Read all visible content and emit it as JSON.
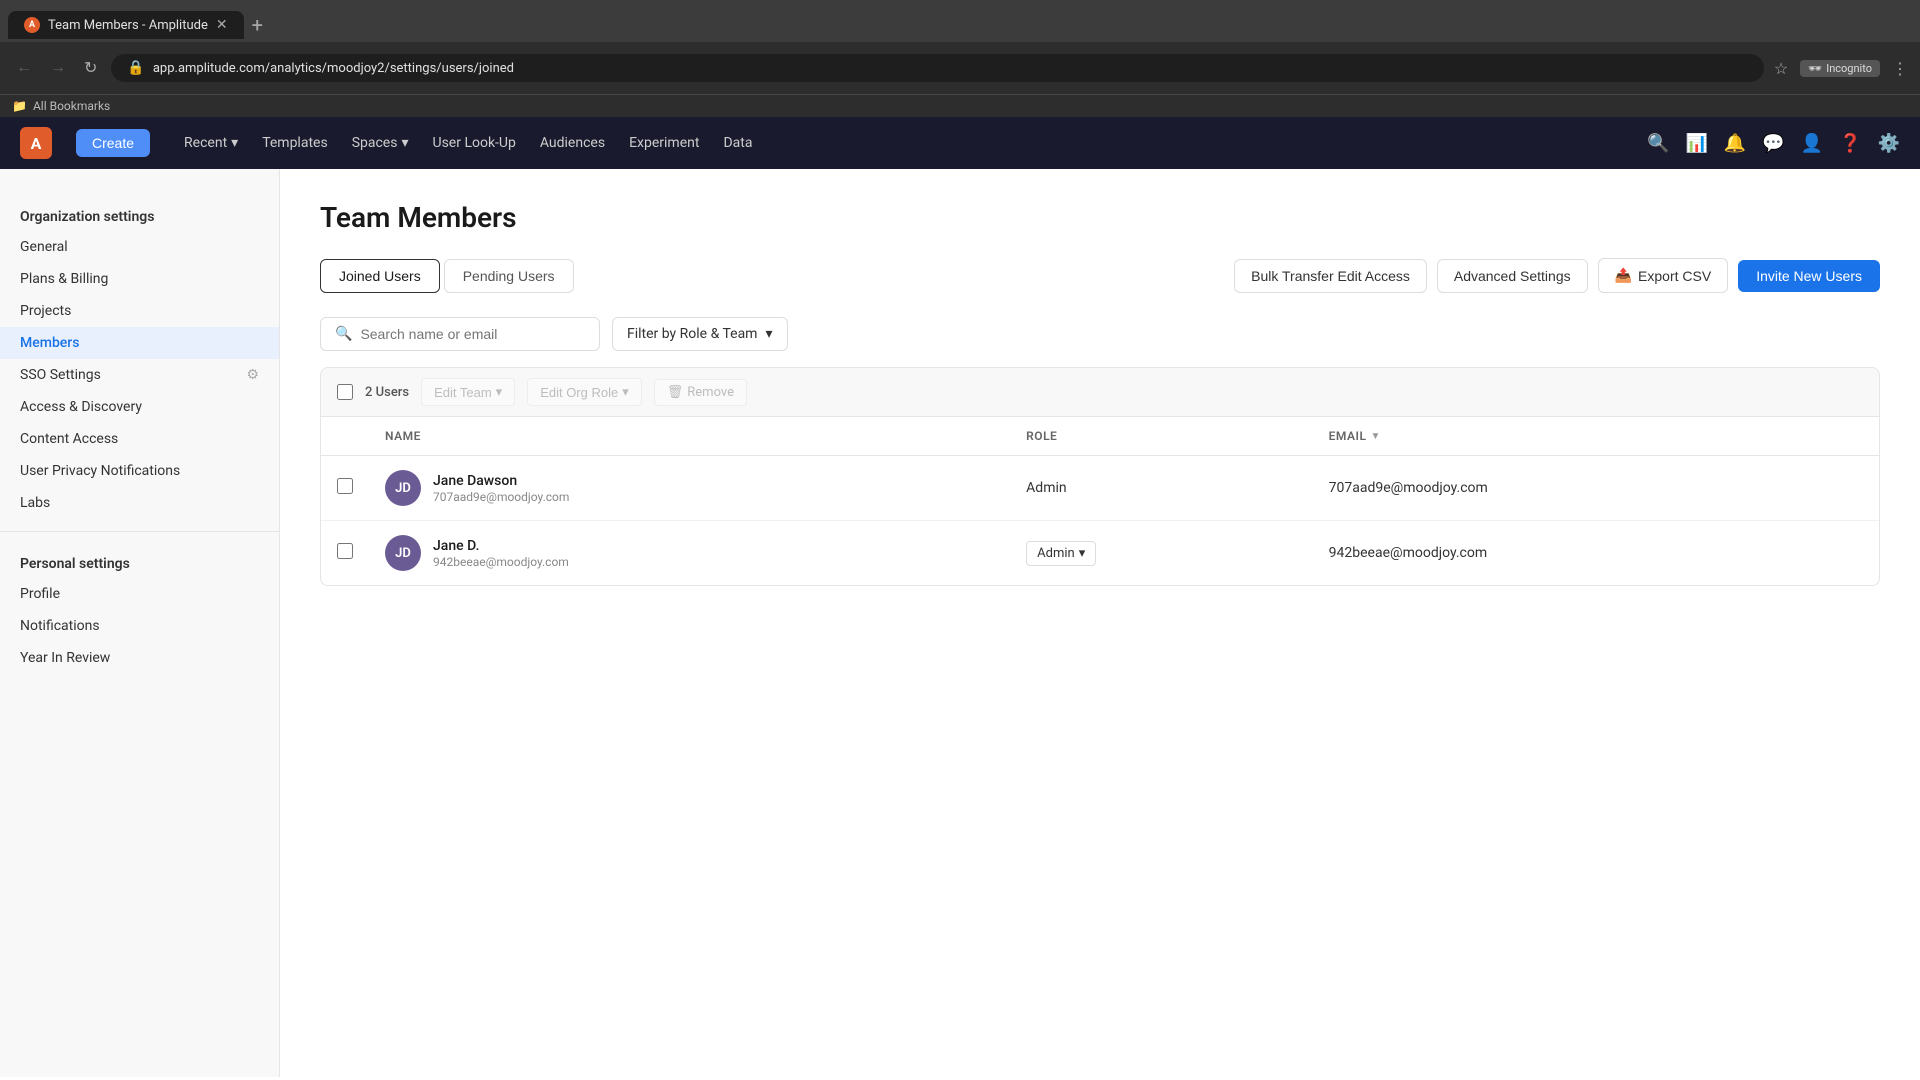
{
  "browser": {
    "tab_title": "Team Members - Amplitude",
    "tab_favicon": "A",
    "url": "app.amplitude.com/analytics/moodjoy2/settings/users/joined",
    "incognito_label": "Incognito",
    "bookmarks_label": "All Bookmarks"
  },
  "topnav": {
    "logo": "A",
    "create_label": "Create",
    "items": [
      {
        "label": "Recent",
        "has_dropdown": true
      },
      {
        "label": "Templates",
        "has_dropdown": false
      },
      {
        "label": "Spaces",
        "has_dropdown": true
      },
      {
        "label": "User Look-Up",
        "has_dropdown": false
      },
      {
        "label": "Audiences",
        "has_dropdown": false
      },
      {
        "label": "Experiment",
        "has_dropdown": false
      },
      {
        "label": "Data",
        "has_dropdown": false
      }
    ]
  },
  "sidebar": {
    "org_section_title": "Organization settings",
    "org_items": [
      {
        "label": "General"
      },
      {
        "label": "Plans & Billing"
      },
      {
        "label": "Projects"
      },
      {
        "label": "Members",
        "active": true
      },
      {
        "label": "SSO Settings"
      },
      {
        "label": "Access & Discovery"
      },
      {
        "label": "Content Access"
      },
      {
        "label": "User Privacy Notifications"
      },
      {
        "label": "Labs"
      }
    ],
    "personal_section_title": "Personal settings",
    "personal_items": [
      {
        "label": "Profile"
      },
      {
        "label": "Notifications"
      },
      {
        "label": "Year In Review"
      }
    ]
  },
  "page": {
    "title": "Team Members",
    "tabs": [
      {
        "label": "Joined Users",
        "active": true
      },
      {
        "label": "Pending Users",
        "active": false
      }
    ],
    "actions": {
      "bulk_transfer": "Bulk Transfer Edit Access",
      "advanced_settings": "Advanced Settings",
      "export_csv": "Export CSV",
      "invite_users": "Invite New Users"
    },
    "search_placeholder": "Search name or email",
    "filter_label": "Filter by Role & Team",
    "bulk_actions": {
      "users_count": "2 Users",
      "edit_team": "Edit Team",
      "edit_org_role": "Edit Org Role",
      "remove": "Remove"
    },
    "table": {
      "columns": [
        {
          "label": "NAME",
          "key": "name"
        },
        {
          "label": "ROLE",
          "key": "role"
        },
        {
          "label": "EMAIL",
          "key": "email",
          "sortable": true
        }
      ],
      "rows": [
        {
          "id": 1,
          "initials": "JD",
          "name": "Jane Dawson",
          "email": "707aad9e@moodjoy.com",
          "role": "Admin",
          "role_dropdown": false,
          "avatar_color": "#6b5b95"
        },
        {
          "id": 2,
          "initials": "JD",
          "name": "Jane D.",
          "email": "942beeae@moodjoy.com",
          "role": "Admin",
          "role_dropdown": true,
          "avatar_color": "#6b5b95"
        }
      ]
    }
  }
}
